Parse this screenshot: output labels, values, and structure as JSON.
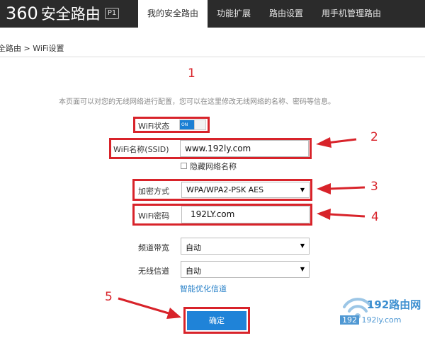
{
  "brand": {
    "logo_number": "360",
    "logo_text": "安全路由",
    "model_badge": "P1"
  },
  "nav": {
    "items": [
      "我的安全路由",
      "功能扩展",
      "路由设置",
      "用手机管理路由"
    ],
    "active_index": 0
  },
  "breadcrumb": "全路由 > WiFi设置",
  "intro": "本页面可以对您的无线网络进行配置，您可以在这里修改无线网络的名称、密码等信息。",
  "form": {
    "wifi_status_label": "WiFi状态",
    "wifi_status_toggle": "ON",
    "wifi_status_on": true,
    "ssid_label": "WiFi名称(SSID)",
    "ssid_value": "www.192ly.com",
    "hide_network_label": "隐藏网络名称",
    "hide_network_checked": false,
    "encryption_label": "加密方式",
    "encryption_value": "WPA/WPA2-PSK AES",
    "password_label": "WiFi密码",
    "password_value": "192LY.com",
    "bandwidth_label": "频道带宽",
    "bandwidth_value": "自动",
    "channel_label": "无线信道",
    "channel_value": "自动",
    "optimize_link": "智能优化信道",
    "confirm_button": "确定"
  },
  "annotations": {
    "n1": "1",
    "n2": "2",
    "n3": "3",
    "n4": "4",
    "n5": "5"
  },
  "watermark": {
    "title": "192路由网",
    "url_prefix": "192",
    "url_rest": "192ly.com"
  },
  "colors": {
    "accent_blue": "#1f83d8",
    "annotation_red": "#d8232a",
    "topbar": "#2b2b2b"
  }
}
